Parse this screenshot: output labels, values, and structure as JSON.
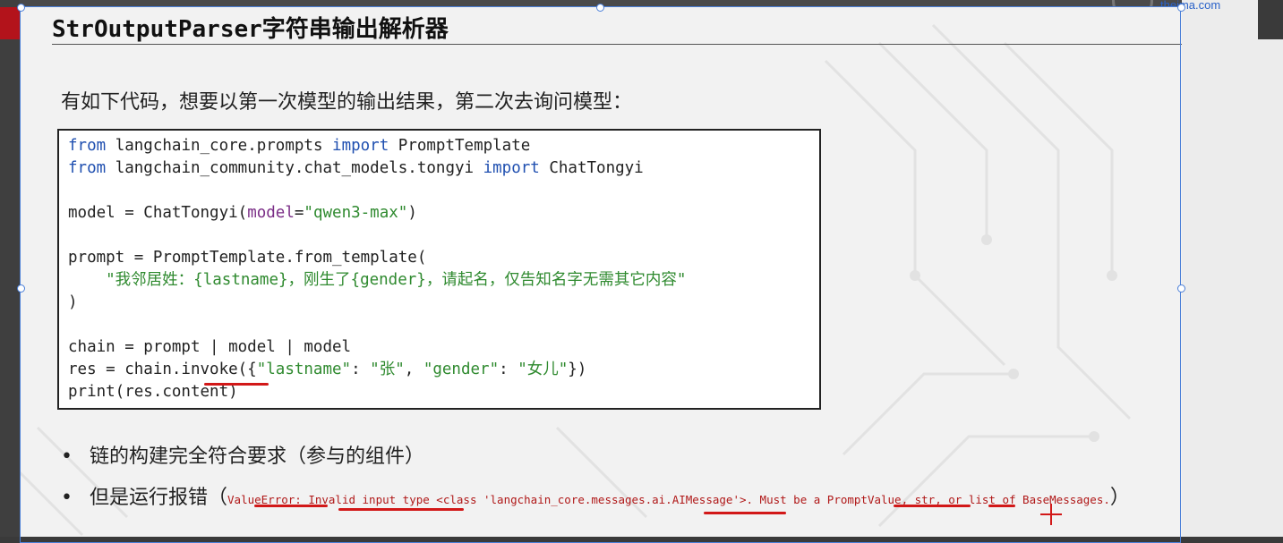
{
  "slide": {
    "title": "StrOutputParser字符串输出解析器",
    "intro": "有如下代码，想要以第一次模型的输出结果，第二次去询问模型：",
    "logo_text": "theima.com"
  },
  "code": {
    "l1_kw1": "from",
    "l1_mod": " langchain_core.prompts ",
    "l1_kw2": "import",
    "l1_name": " PromptTemplate",
    "l2_kw1": "from",
    "l2_mod": " langchain_community.chat_models.tongyi ",
    "l2_kw2": "import",
    "l2_name": " ChatTongyi",
    "l4_a": "model = ChatTongyi(",
    "l4_arg": "model",
    "l4_eq": "=",
    "l4_str": "\"qwen3-max\"",
    "l4_b": ")",
    "l6": "prompt = PromptTemplate.from_template(",
    "l7_str": "    \"我邻居姓：{lastname}，刚生了{gender}，请起名，仅告知名字无需其它内容\"",
    "l8": ")",
    "l10": "chain = prompt | model | model",
    "l11_a": "res = chain.invoke({",
    "l11_s1": "\"lastname\"",
    "l11_b": ": ",
    "l11_s2": "\"张\"",
    "l11_c": ", ",
    "l11_s3": "\"gender\"",
    "l11_d": ": ",
    "l11_s4": "\"女儿\"",
    "l11_e": "})",
    "l12": "print(res.content)"
  },
  "bullets": {
    "b1": "链的构建完全符合要求（参与的组件）",
    "b2_prefix": "但是运行报错（",
    "b2_error": "ValueError: Invalid input type <class 'langchain_core.messages.ai.AIMessage'>. Must be a PromptValue, str, or list of BaseMessages.",
    "b2_suffix": "）",
    "dot": "•"
  },
  "colors": {
    "keyword": "#1f4fb0",
    "string": "#2f8a2f",
    "argument": "#7a2d86",
    "error": "#b01818",
    "annotation": "#d21818",
    "brand_red": "#b3131b"
  }
}
